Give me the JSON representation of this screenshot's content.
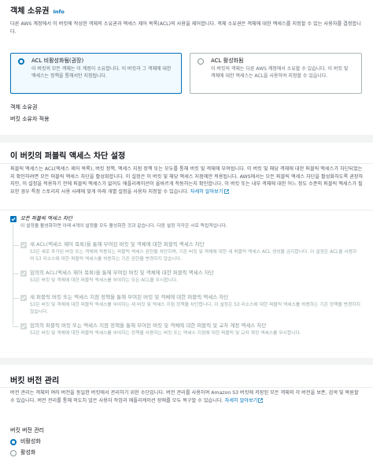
{
  "ownership": {
    "title": "객체 소유권",
    "info_link": "Info",
    "description": "다른 AWS 계정에서 이 버킷에 작성한 객체의 소유권과 액세스 제어 목록(ACL)의 사용을 제어합니다. 객체 소유권은 객체에 대한 액세스를 지정할 수 있는 사용자를 결정합니다.",
    "options": [
      {
        "title": "ACL 비활성화됨(권장)",
        "description": "이 버킷의 모든 객체는 이 계정이 소유합니다. 이 버킷과 그 객체에 대한 액세스는 정책을 통해서만 지정됩니다.",
        "selected": true
      },
      {
        "title": "ACL 활성화됨",
        "description": "이 버킷의 객체는 다른 AWS 계정에서 소유할 수 있습니다. 이 버킷 및 객체에 대한 액세스는 ACL을 사용하여 지정할 수 있습니다.",
        "selected": false
      }
    ],
    "field_label": "객체 소유권",
    "field_value": "버킷 소유자 적용"
  },
  "public_access": {
    "title": "이 버킷의 퍼블릭 액세스 차단 설정",
    "description": "퍼블릭 액세스는 ACL(액세스 제어 목록), 버킷 정책, 액세스 지점 정책 또는 모두를 통해 버킷 및 객체에 부여됩니다. 이 버킷 및 해당 객체에 대한 퍼블릭 액세스가 차단되었는지 확인하려면 모든 퍼블릭 액세스 차단을 활성화합니다. 이 설정은 이 버킷 및 해당 액세스 지점에만 적용됩니다. AWS에서는 모든 퍼블릭 액세스 차단을 활성화하도록 권장하지만, 이 설정을 적용하기 전에 퍼블릭 액세스가 없어도 애플리케이션이 올바르게 작동하는지 확인합니다. 이 버킷 또는 내부 객체에 대한 어느 정도 수준의 퍼블릭 액세스가 필요한 경우 특정 스토리지 사용 사례에 맞게 아래 개별 설정을 사용자 지정할 수 있습니다.",
    "learn_more": "자세히 알아보기",
    "block_all": {
      "title": "모든 퍼블릭 액세스 차단",
      "description": "이 설정을 활성화하면 아래 4개의 설정을 모두 활성화한 것과 같습니다. 다음 설정 각각은 서로 독립적입니다.",
      "checked": true
    },
    "sub_options": [
      {
        "title": "새 ACL(액세스 제어 목록)을 통해 부여된 버킷 및 객체에 대한 퍼블릭 액세스 차단",
        "description": "S3은 새로 추가된 버킷 또는 객체에 적용되는 퍼블릭 액세스 권한을 차단하며, 기존 버킷 및 객체에 대한 새 퍼블릭 액세스 ACL 생성을 금지합니다. 이 설정은 ACL을 사용하여 S3 리소스에 대한 퍼블릭 액세스를 허용하는 기존 권한을 변경하지 않습니다."
      },
      {
        "title": "임의의 ACL(액세스 제어 목록)을 통해 부여된 버킷 및 객체에 대한 퍼블릭 액세스 차단",
        "description": "S3은 버킷 및 객체에 대한 퍼블릭 액세스를 부여하는 모든 ACL을 무시합니다."
      },
      {
        "title": "새 퍼블릭 버킷 또는 액세스 지점 정책을 통해 부여된 버킷 및 객체에 대한 퍼블릭 액세스 차단",
        "description": "S3은 버킷 및 객체에 대한 퍼블릭 액세스를 부여하는 새 버킷 및 액세스 지점 정책을 차단합니다. 이 설정은 S3 리소스에 대한 퍼블릭 액세스를 허용하는 기존 정책을 변경하지 않습니다."
      },
      {
        "title": "임의의 퍼블릭 버킷 또는 액세스 지점 정책을 통해 부여된 버킷 및 객체에 대한 퍼블릭 및 교차 계정 액세스 차단",
        "description": "S3은 버킷 및 객체에 대한 퍼블릭 액세스를 부여하는 정책을 사용하는 버킷 또는 액세스 지점에 대한 퍼블릭 및 교차 계정 액세스를 무시합니다."
      }
    ]
  },
  "versioning": {
    "title": "버킷 버전 관리",
    "description": "버전 관리는 객체의 여러 버전을 동일한 버킷에서 관리하기 위한 수단입니다. 버전 관리를 사용하여 Amazon S3 버킷에 저장된 모든 객체의 각 버전을 보존, 검색 및 복원할 수 있습니다. 버전 관리를 통해 의도치 않은 사용자 작업과 애플리케이션 장애를 모두 복구할 수 있습니다.",
    "learn_more": "자세히 알아보기",
    "field_label": "버킷 버전 관리",
    "options": [
      {
        "label": "비활성화",
        "selected": true
      },
      {
        "label": "활성화",
        "selected": false
      }
    ]
  },
  "colors": {
    "accent": "#0073bb",
    "disabled": "#d5dbdb"
  }
}
